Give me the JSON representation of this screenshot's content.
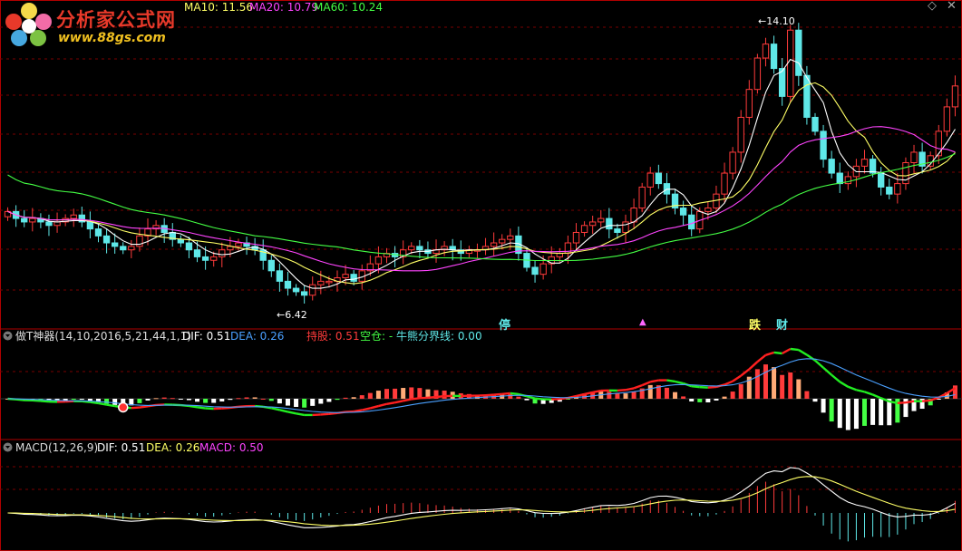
{
  "header": {
    "logo_title": "分析家公式网",
    "logo_url": "www.88gs.com",
    "ma10_label": "MA10: 11.56",
    "ma20_label": "MA20: 10.79",
    "ma60_label": "MA60: 10.24"
  },
  "colors": {
    "up": "#ff3b3b",
    "down": "#5fe8e8",
    "ma5": "#ffffff",
    "ma10": "#ffff66",
    "ma20": "#ff44ff",
    "ma60": "#44ff44",
    "dea": "#4aa0ff",
    "grid": "#7a0000"
  },
  "price_panel": {
    "high_label": "14.10",
    "low_label": "6.42",
    "markers": [
      {
        "text": "停",
        "color": "#5fe8e8"
      },
      {
        "text": "跌",
        "color": "#ffff66"
      },
      {
        "text": "财",
        "color": "#5fe8e8"
      }
    ]
  },
  "indicator1": {
    "name": "做T神器(14,10,2016,5,21,44,1,1)",
    "dif_label": "DIF: 0.51",
    "dea_label": "DEA: 0.26",
    "hold_label": "持股: 0.51",
    "empty_label": "空仓: -",
    "bull_bear_label": "牛熊分界线: 0.00"
  },
  "indicator2": {
    "name": "MACD(12,26,9)",
    "dif_label": "DIF: 0.51",
    "dea_label": "DEA: 0.26",
    "macd_label": "MACD: 0.50"
  },
  "chart_data": {
    "type": "candlestick",
    "y_range": [
      6.0,
      14.6
    ],
    "annotated_high": 14.1,
    "annotated_low": 6.42,
    "candles_close": [
      8.9,
      8.7,
      8.6,
      8.7,
      8.6,
      8.5,
      8.6,
      8.7,
      8.8,
      8.6,
      8.4,
      8.2,
      8.0,
      7.9,
      7.8,
      7.9,
      8.2,
      8.4,
      8.5,
      8.3,
      8.1,
      8.0,
      7.8,
      7.6,
      7.5,
      7.6,
      7.8,
      7.9,
      8.0,
      7.9,
      7.8,
      7.5,
      7.2,
      6.9,
      6.7,
      6.6,
      6.5,
      6.8,
      6.9,
      6.9,
      7.0,
      7.1,
      6.9,
      7.2,
      7.4,
      7.6,
      7.7,
      7.6,
      7.8,
      7.9,
      7.8,
      7.7,
      7.8,
      7.9,
      7.8,
      7.7,
      7.8,
      7.8,
      7.9,
      8.0,
      8.1,
      8.2,
      7.7,
      7.3,
      7.1,
      7.4,
      7.6,
      7.7,
      8.0,
      8.3,
      8.5,
      8.6,
      8.7,
      8.4,
      8.3,
      8.6,
      9.0,
      9.6,
      10.0,
      9.7,
      9.4,
      9.0,
      8.8,
      8.4,
      8.9,
      9.0,
      9.4,
      10.0,
      10.6,
      11.6,
      12.4,
      13.3,
      13.7,
      13.0,
      12.2,
      14.1,
      12.8,
      11.6,
      11.2,
      10.4,
      10.0,
      9.7,
      9.9,
      10.2,
      10.4,
      10.0,
      9.6,
      9.4,
      9.7,
      10.3,
      10.6,
      10.2,
      10.5,
      11.2,
      11.9,
      12.5
    ],
    "ma_series": [
      {
        "name": "MA10",
        "value": 11.56
      },
      {
        "name": "MA20",
        "value": 10.79
      },
      {
        "name": "MA60",
        "value": 10.24
      }
    ]
  }
}
